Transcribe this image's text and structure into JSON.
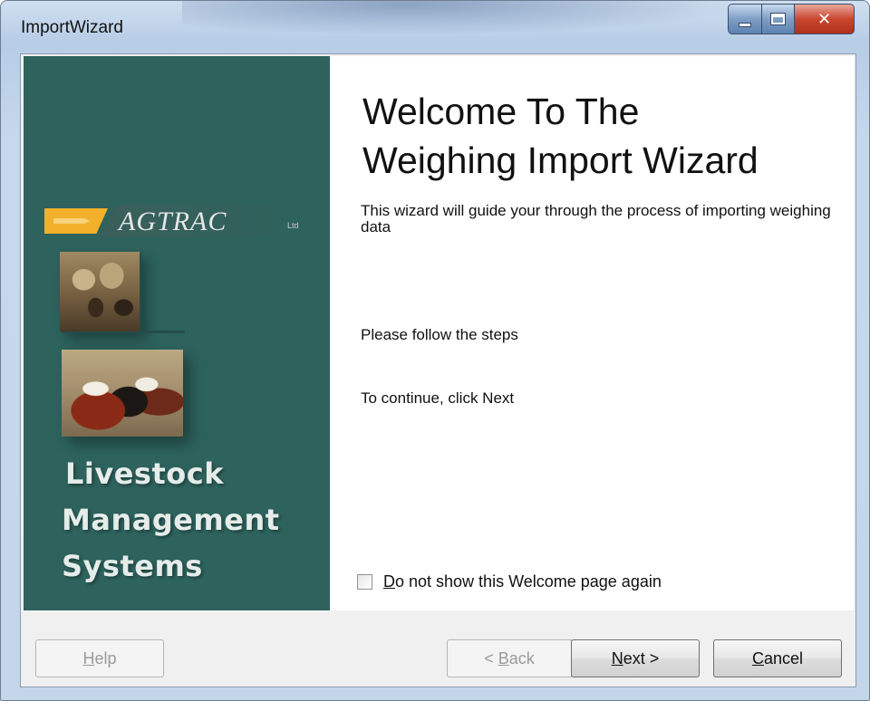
{
  "window": {
    "title": "ImportWizard"
  },
  "branding": {
    "logo_text": "AGTRAC",
    "logo_suffix": "Ltd",
    "tagline_lines": [
      "Livestock",
      "Management",
      "Systems"
    ]
  },
  "content": {
    "title_line1": "Welcome To The",
    "title_line2": "Weighing Import Wizard",
    "intro": "This wizard will guide your through the process of importing weighing data",
    "steps": "Please follow the steps",
    "continue": "To continue, click Next",
    "checkbox": {
      "label_mnemonic": "D",
      "label_rest": "o not show this Welcome page again",
      "checked": false
    }
  },
  "buttons": {
    "help": {
      "mnemonic": "H",
      "rest": "elp",
      "enabled": false
    },
    "back": {
      "prefix": "< ",
      "mnemonic": "B",
      "rest": "ack",
      "enabled": false
    },
    "next": {
      "mnemonic": "N",
      "rest": "ext >",
      "enabled": true
    },
    "cancel": {
      "mnemonic": "C",
      "rest": "ancel",
      "enabled": true
    }
  },
  "colors": {
    "side_panel": "#2d625d",
    "logo_accent": "#f2b02b"
  },
  "icons": [
    "minimize-icon",
    "maximize-icon",
    "close-icon",
    "sheep-photo",
    "cattle-photo",
    "agtrac-logo"
  ]
}
